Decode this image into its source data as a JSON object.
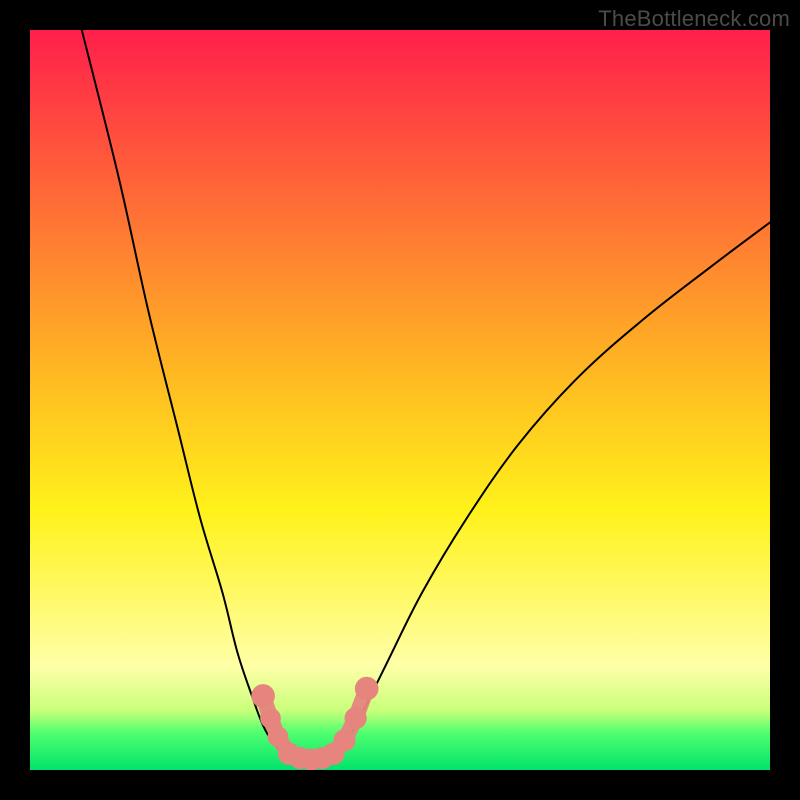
{
  "watermark": "TheBottleneck.com",
  "chart_data": {
    "type": "line",
    "title": "",
    "xlabel": "",
    "ylabel": "",
    "xlim": [
      0,
      100
    ],
    "ylim": [
      0,
      100
    ],
    "grid": false,
    "legend": false,
    "background": {
      "kind": "vertical-gradient",
      "stops": [
        {
          "y": 0,
          "color": "#ff1f4b"
        },
        {
          "y": 45,
          "color": "#ffb423"
        },
        {
          "y": 65,
          "color": "#fff21a"
        },
        {
          "y": 86,
          "color": "#ffffa8"
        },
        {
          "y": 92,
          "color": "#c8ff7a"
        },
        {
          "y": 95,
          "color": "#4fff6f"
        },
        {
          "y": 100,
          "color": "#00e36a"
        }
      ]
    },
    "series": [
      {
        "name": "left-branch",
        "color": "#000000",
        "x": [
          7,
          12,
          16,
          20,
          23,
          26,
          28,
          30,
          31.5,
          33,
          34.5
        ],
        "y": [
          100,
          80,
          62,
          46,
          34,
          24,
          16,
          10,
          6,
          3.5,
          2
        ]
      },
      {
        "name": "valley",
        "color": "#000000",
        "x": [
          34.5,
          36,
          38,
          40,
          41.5
        ],
        "y": [
          2,
          1.2,
          1,
          1.3,
          2.2
        ]
      },
      {
        "name": "right-branch",
        "color": "#000000",
        "x": [
          41.5,
          44,
          48,
          53,
          59,
          66,
          74,
          83,
          92,
          100
        ],
        "y": [
          2.2,
          6,
          14,
          24,
          34,
          44,
          53,
          61,
          68,
          74
        ]
      }
    ],
    "markers": [
      {
        "name": "left-hi",
        "x": 31.5,
        "y": 10,
        "r": 1.6,
        "color": "#e6857e"
      },
      {
        "name": "left-mid",
        "x": 32.5,
        "y": 7,
        "r": 1.4,
        "color": "#e6857e"
      },
      {
        "name": "left-lo",
        "x": 33.5,
        "y": 4.5,
        "r": 1.4,
        "color": "#e6857e"
      },
      {
        "name": "bot-1",
        "x": 35,
        "y": 2.2,
        "r": 1.5,
        "color": "#e6857e"
      },
      {
        "name": "bot-2",
        "x": 36.5,
        "y": 1.6,
        "r": 1.5,
        "color": "#e6857e"
      },
      {
        "name": "bot-3",
        "x": 38,
        "y": 1.4,
        "r": 1.5,
        "color": "#e6857e"
      },
      {
        "name": "bot-4",
        "x": 39.5,
        "y": 1.6,
        "r": 1.5,
        "color": "#e6857e"
      },
      {
        "name": "bot-5",
        "x": 41,
        "y": 2.2,
        "r": 1.5,
        "color": "#e6857e"
      },
      {
        "name": "right-lo",
        "x": 42.5,
        "y": 4,
        "r": 1.5,
        "color": "#e6857e"
      },
      {
        "name": "right-mid",
        "x": 44,
        "y": 7,
        "r": 1.5,
        "color": "#e6857e"
      },
      {
        "name": "right-hi",
        "x": 45.5,
        "y": 11,
        "r": 1.6,
        "color": "#e6857e"
      }
    ]
  }
}
